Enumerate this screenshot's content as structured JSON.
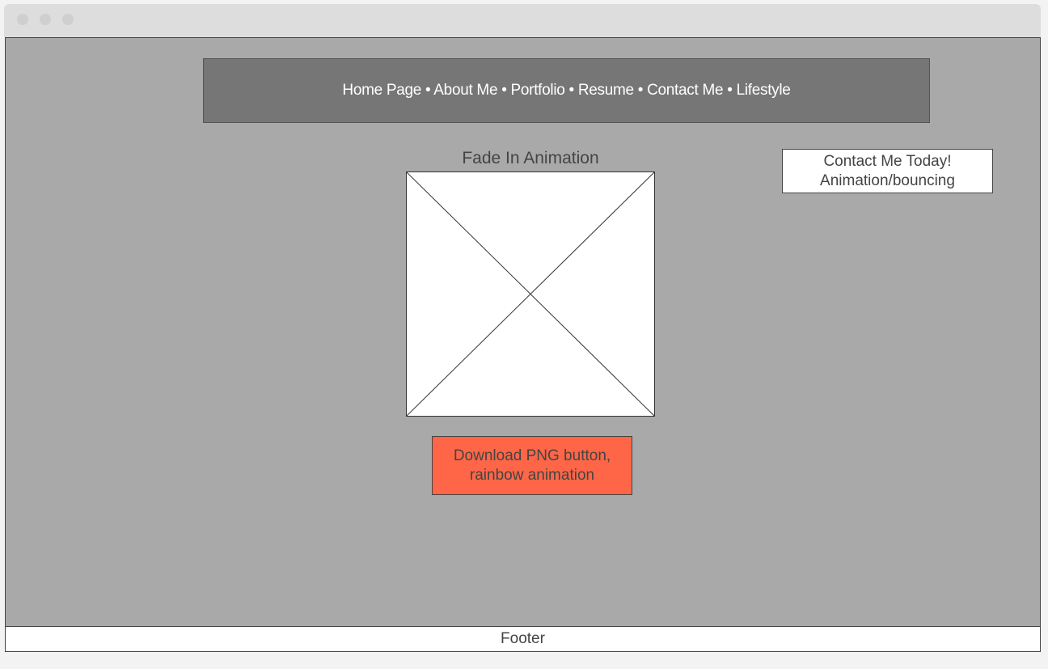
{
  "nav": {
    "text": "Home Page • About Me • Portfolio • Resume • Contact Me • Lifestyle"
  },
  "main": {
    "image_title": "Fade In Animation",
    "download_button_label": "Download PNG button,\nrainbow animation"
  },
  "contact": {
    "label": "Contact Me Today!\nAnimation/bouncing"
  },
  "footer": {
    "label": "Footer"
  },
  "colors": {
    "page_background": "#a9a9a9",
    "nav_background": "#767676",
    "download_button": "#ff6647",
    "title_bar": "#dddddd"
  }
}
